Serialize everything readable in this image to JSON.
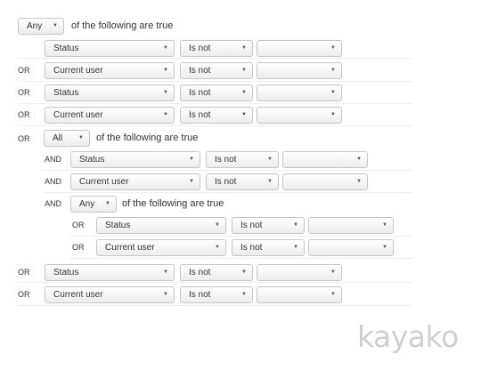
{
  "groups": {
    "top": {
      "quantifier": "Any",
      "phrase": "of the following are true"
    },
    "nested": {
      "conjunction": "OR",
      "quantifier": "All",
      "phrase": "of the following are true"
    },
    "inner": {
      "conjunction": "AND",
      "quantifier": "Any",
      "phrase": "of the following are true"
    }
  },
  "rows": [
    {
      "conjunction": "",
      "field": "Status",
      "operator": "Is not",
      "value": ""
    },
    {
      "conjunction": "OR",
      "field": "Current user",
      "operator": "Is not",
      "value": ""
    },
    {
      "conjunction": "OR",
      "field": "Status",
      "operator": "Is not",
      "value": ""
    },
    {
      "conjunction": "OR",
      "field": "Current user",
      "operator": "Is not",
      "value": ""
    },
    {
      "conjunction": "AND",
      "field": "Status",
      "operator": "Is not",
      "value": ""
    },
    {
      "conjunction": "AND",
      "field": "Current user",
      "operator": "Is not",
      "value": ""
    },
    {
      "conjunction": "OR",
      "field": "Status",
      "operator": "Is not",
      "value": ""
    },
    {
      "conjunction": "OR",
      "field": "Current user",
      "operator": "Is not",
      "value": ""
    },
    {
      "conjunction": "OR",
      "field": "Status",
      "operator": "Is not",
      "value": ""
    },
    {
      "conjunction": "OR",
      "field": "Current user",
      "operator": "Is not",
      "value": ""
    }
  ],
  "icons": {
    "dropdown": "chevron-down-icon"
  },
  "brand": {
    "logo_text": "kayako",
    "logo_color": "#cfcfcf"
  }
}
